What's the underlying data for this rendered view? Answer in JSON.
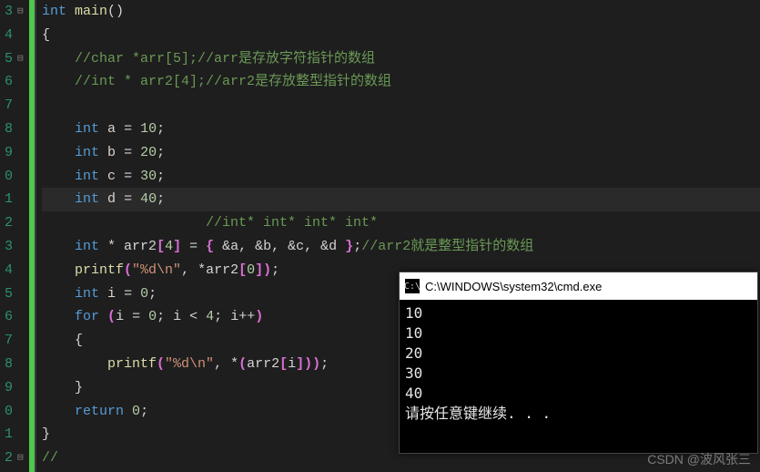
{
  "gutter": [
    "3",
    "4",
    "5",
    "6",
    "7",
    "8",
    "9",
    "0",
    "1",
    "2",
    "3",
    "4",
    "5",
    "6",
    "7",
    "8",
    "9",
    "0",
    "1",
    "2"
  ],
  "code": {
    "l0": {
      "kw1": "int",
      "fn": " main",
      "pln": "()"
    },
    "l1": {
      "pln": "{"
    },
    "l2": {
      "cmt": "    //char *arr[5];//arr是存放字符指针的数组"
    },
    "l3": {
      "cmt": "    //int * arr2[4];//arr2是存放整型指针的数组"
    },
    "l4": {
      "pln": ""
    },
    "l5": {
      "pad": "    ",
      "kw": "int",
      "sp": " ",
      "id": "a",
      "eq": " = ",
      "num": "10",
      "semi": ";"
    },
    "l6": {
      "pad": "    ",
      "kw": "int",
      "sp": " ",
      "id": "b",
      "eq": " = ",
      "num": "20",
      "semi": ";"
    },
    "l7": {
      "pad": "    ",
      "kw": "int",
      "sp": " ",
      "id": "c",
      "eq": " = ",
      "num": "30",
      "semi": ";"
    },
    "l8": {
      "pad": "    ",
      "kw": "int",
      "sp": " ",
      "id": "d",
      "eq": " = ",
      "num": "40",
      "semi": ";"
    },
    "l9": {
      "cmt": "                    //int* int* int* int*"
    },
    "l10": {
      "pad": "    ",
      "kw": "int",
      "star": " * ",
      "id": "arr2",
      "br1": "[",
      "num": "4",
      "br2": "]",
      "eq": " = ",
      "br3": "{ ",
      "args": "&a, &b, &c, &d ",
      "br4": "}",
      "semi": ";",
      "cmt": "//arr2就是整型指针的数组"
    },
    "l11": {
      "pad": "    ",
      "fn": "printf",
      "p1": "(",
      "str": "\"%d\\n\"",
      "c": ", *",
      "id": "arr2",
      "br1": "[",
      "num": "0",
      "br2": "]",
      "p2": ")",
      "semi": ";"
    },
    "l12": {
      "pad": "    ",
      "kw": "int",
      "sp": " ",
      "id": "i",
      "eq": " = ",
      "num": "0",
      "semi": ";"
    },
    "l13": {
      "pad": "    ",
      "kw": "for",
      "sp": " ",
      "p1": "(",
      "id1": "i",
      "eq1": " = ",
      "n1": "0",
      "s1": "; ",
      "id2": "i",
      "lt": " < ",
      "n2": "4",
      "s2": "; ",
      "id3": "i",
      "pp": "++",
      "p2": ")"
    },
    "l14": {
      "pln": "    {"
    },
    "l15": {
      "pad": "        ",
      "fn": "printf",
      "p1": "(",
      "str": "\"%d\\n\"",
      "c": ", *",
      "p2": "(",
      "id": "arr2",
      "br1": "[",
      "id2": "i",
      "br2": "]",
      "p3": "))",
      "semi": ";"
    },
    "l16": {
      "pln": "    }"
    },
    "l17": {
      "pad": "    ",
      "kw": "return",
      "sp": " ",
      "num": "0",
      "semi": ";"
    },
    "l18": {
      "pln": "}"
    },
    "l19": {
      "cmt": "//"
    }
  },
  "console": {
    "title": "C:\\WINDOWS\\system32\\cmd.exe",
    "icon": "C:\\",
    "lines": [
      "10",
      "10",
      "20",
      "30",
      "40",
      "请按任意键继续. . ."
    ]
  },
  "watermark": "CSDN @波风张三"
}
